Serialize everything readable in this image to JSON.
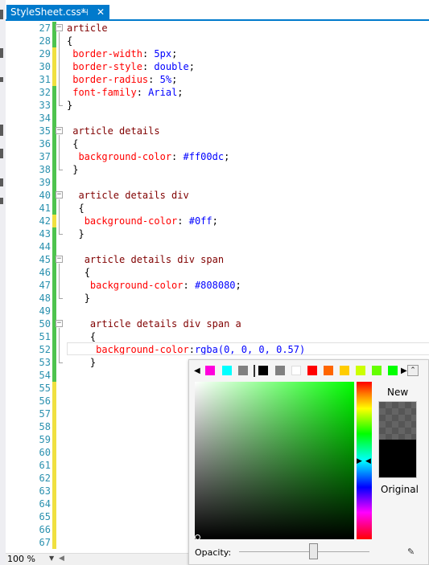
{
  "tab": {
    "title": "StyleSheet.css*",
    "pin_glyph": "⊣",
    "close_glyph": "✕"
  },
  "colors": {
    "accent": "#007acc",
    "line_number": "#2b91af",
    "selector": "#800000",
    "property": "#ff0000",
    "value": "#0000ff",
    "saved_marker": "#4ec34e",
    "unsaved_marker": "#f0e040"
  },
  "editor": {
    "line_numbers": [
      "27",
      "28",
      "29",
      "30",
      "31",
      "32",
      "33",
      "34",
      "35",
      "36",
      "37",
      "38",
      "39",
      "40",
      "41",
      "42",
      "43",
      "44",
      "45",
      "46",
      "47",
      "48",
      "49",
      "50",
      "51",
      "52",
      "53",
      "54",
      "55",
      "56",
      "57",
      "58",
      "59",
      "60",
      "61",
      "62",
      "63",
      "64",
      "65",
      "66",
      "67"
    ],
    "lines": [
      {
        "indent": "",
        "selector": "article"
      },
      {
        "indent": "",
        "punct": "{"
      },
      {
        "indent": " ",
        "prop": "border-width",
        "val": "5px"
      },
      {
        "indent": " ",
        "prop": "border-style",
        "val": "double"
      },
      {
        "indent": " ",
        "prop": "border-radius",
        "val": "5%"
      },
      {
        "indent": " ",
        "prop": "font-family",
        "val": "Arial"
      },
      {
        "indent": "",
        "punct": "}"
      },
      {
        "indent": "",
        "punct": ""
      },
      {
        "indent": " ",
        "selector": "article details"
      },
      {
        "indent": " ",
        "punct": "{"
      },
      {
        "indent": "  ",
        "prop": "background-color",
        "val": "#ff00dc"
      },
      {
        "indent": " ",
        "punct": "}"
      },
      {
        "indent": "",
        "punct": ""
      },
      {
        "indent": "  ",
        "selector": "article details div"
      },
      {
        "indent": "  ",
        "punct": "{"
      },
      {
        "indent": "   ",
        "prop": "background-color",
        "val": "#0ff"
      },
      {
        "indent": "  ",
        "punct": "}"
      },
      {
        "indent": "",
        "punct": ""
      },
      {
        "indent": "   ",
        "selector": "article details div span"
      },
      {
        "indent": "   ",
        "punct": "{"
      },
      {
        "indent": "    ",
        "prop": "background-color",
        "val": "#808080"
      },
      {
        "indent": "   ",
        "punct": "}"
      },
      {
        "indent": "",
        "punct": ""
      },
      {
        "indent": "    ",
        "selector": "article details div span a"
      },
      {
        "indent": "    ",
        "punct": "{"
      },
      {
        "indent": "     ",
        "prop": "background-color",
        "val": "rgba(0, 0, 0, 0.57)",
        "nospace": true
      },
      {
        "indent": "    ",
        "punct": "}"
      }
    ]
  },
  "status": {
    "zoom": "100 %",
    "dropdown_glyph": "▼",
    "scroll_left_glyph": "◀"
  },
  "color_picker": {
    "swatches": [
      "#ff00dc",
      "#00ffff",
      "#808080",
      "#000000",
      "#808080",
      "#ffffff",
      "#ff0000",
      "#ff6600",
      "#ffcc00",
      "#ccff00",
      "#66ff00",
      "#00ff00"
    ],
    "new_label": "New",
    "original_label": "Original",
    "opacity_label": "Opacity:",
    "opacity_value": 0.57,
    "new_color": "rgba(0, 0, 0, 0.57)",
    "original_color": "#000000",
    "hue_color": "#00ff00",
    "collapse_glyph": "⌃",
    "eyedropper_glyph": "✎"
  }
}
